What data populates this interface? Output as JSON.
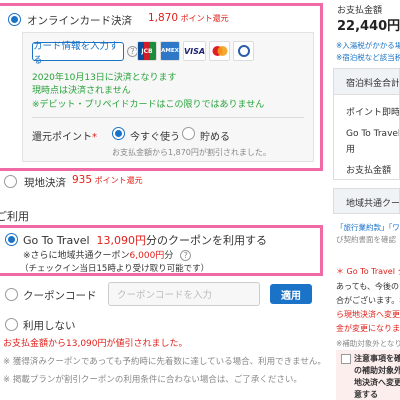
{
  "online_payment": {
    "label": "オンラインカード決済",
    "points": "1,870",
    "points_unit": "ポイント還元",
    "card_button": "カード情報を入力する",
    "help_icon": "?",
    "card_brands": [
      "JCB",
      "AMEX",
      "VISA",
      "MasterCard",
      "Diners"
    ],
    "settlement_note_1": "2020年10月13日に決済となります",
    "settlement_note_2": "現時点は決済されません",
    "debit_note": "※デビット・プリペイドカードはこの限りではありません",
    "return_points_label": "還元ポイント",
    "required_mark": "*",
    "use_now": "今すぐ使う",
    "save": "貯める",
    "deduct_note": "お支払金額から1,870円が割引されました。"
  },
  "onsite_payment": {
    "label": "現地決済",
    "points": "935",
    "points_unit": "ポイント還元"
  },
  "coupon_section": {
    "heading": "ご利用",
    "goto_label": "Go To Travel",
    "goto_amount": "13,090円",
    "goto_suffix": "分のクーポンを利用する",
    "regional_prefix": "※さらに地域共通クーポン",
    "regional_amount": "6,000円",
    "regional_suffix": "分",
    "regional_help": "?",
    "checkin_note": "（チェックイン当日15時より受け取り可能です）",
    "coupon_code_label": "クーポンコード",
    "coupon_code_placeholder": "クーポンコードを入力",
    "apply_button": "適用",
    "no_use_label": "利用しない",
    "discount_note": "お支払金額から13,090円が値引されました。",
    "footnote_1": "※ 獲得済みクーポンであっても予約時に先着数に達している場合、利用できません。",
    "footnote_2": "※ 掲載プランが割引クーポンの利用条件に合わない場合は、ご了承ください。"
  },
  "sidebar": {
    "total_label": "お支払金額",
    "total_value": "22,440円",
    "tax_note": "※入湯税がかかる場",
    "tax_note2": "※宿泊税など該当税",
    "rows": [
      "宿泊料金合計",
      "ポイント即時",
      "Go To Travel",
      "用",
      "お支払金額"
    ],
    "regional_coupon": "地域共通クー",
    "travel_links": "「旅行業約款」「ワ",
    "travel_links2": "び契約書面を確認",
    "goto_notice_1": "＊ Go To Travel ク",
    "goto_notice_2": "あっても、今後の",
    "goto_notice_3": "合がございます。本",
    "goto_notice_4": "ら現地決済へ変更",
    "goto_notice_5": "金が変更になります",
    "goto_notice_6": "※補助対象外となり",
    "checkbox_1": "注意事項を確",
    "checkbox_2": "の補助対象外",
    "checkbox_3": "地決済へ変更",
    "checkbox_4": "意する"
  }
}
